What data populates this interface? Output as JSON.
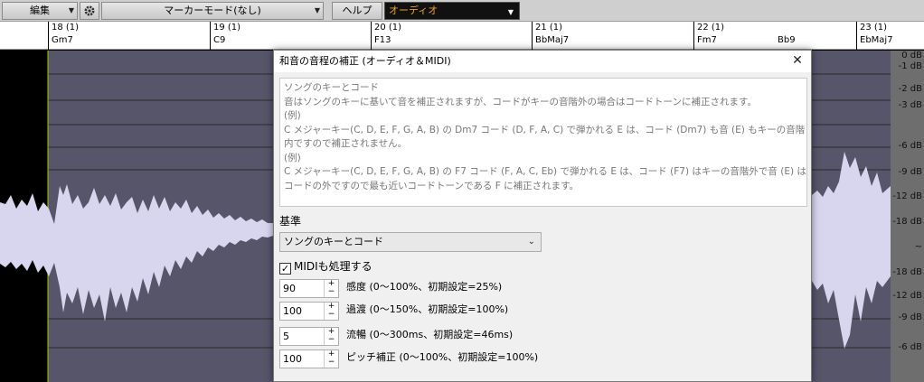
{
  "toolbar": {
    "edit_label": "編集",
    "marker_label": "マーカーモード(なし)",
    "help_label": "ヘルプ",
    "audio_label": "オーディオ"
  },
  "ruler": {
    "bars": [
      {
        "num": "18 (1)",
        "chord": "Gm7"
      },
      {
        "num": "19 (1)",
        "chord": "C9"
      },
      {
        "num": "20 (1)",
        "chord": "F13"
      },
      {
        "num": "21 (1)",
        "chord": "BbMaj7"
      },
      {
        "num": "22 (1)",
        "chord": "Fm7"
      },
      {
        "num": "23 (1)",
        "chord": "EbMaj7"
      }
    ],
    "extra_chord": "Bb9"
  },
  "db_scale": [
    "0 dB",
    "-1 dB",
    "-2 dB",
    "-3 dB",
    "-6 dB",
    "-9 dB",
    "-12 dB",
    "-18 dB",
    "~",
    "-18 dB",
    "-12 dB",
    "-9 dB",
    "-6 dB"
  ],
  "dialog": {
    "title": "和音の音程の補正 (オーディオ＆MIDI)",
    "close_icon": "close-icon",
    "info_lines": [
      "ソングのキーとコード",
      "音はソングのキーに基いて音を補正されますが、コードがキーの音階外の場合はコードトーンに補正されます。",
      "(例)",
      "C メジャーキー(C, D, E, F, G, A, B) の Dm7 コード (D, F, A, C) で弾かれる E は、コード (Dm7) も音 (E) もキーの音階",
      "内ですので補正されません。",
      "(例)",
      "C メジャーキー(C, D, E, F, G, A, B) の F7 コード (F, A, C, Eb) で弾かれる E は、コード (F7) はキーの音階外で音 (E) は",
      "コードの外ですので最も近いコードトーンである F に補正されます。"
    ],
    "basis_label": "基準",
    "basis_value": "ソングのキーとコード",
    "midi_label": "MIDIも処理する",
    "midi_checked": true,
    "params": [
      {
        "value": "90",
        "label": "感度 (0～100%、初期設定=25%)"
      },
      {
        "value": "100",
        "label": "過渡 (0～150%、初期設定=100%)"
      },
      {
        "value": "5",
        "label": "流暢 (0～300ms、初期設定=46ms)"
      },
      {
        "value": "100",
        "label": "ピッチ補正 (0～100%、初期設定=100%)"
      }
    ]
  }
}
